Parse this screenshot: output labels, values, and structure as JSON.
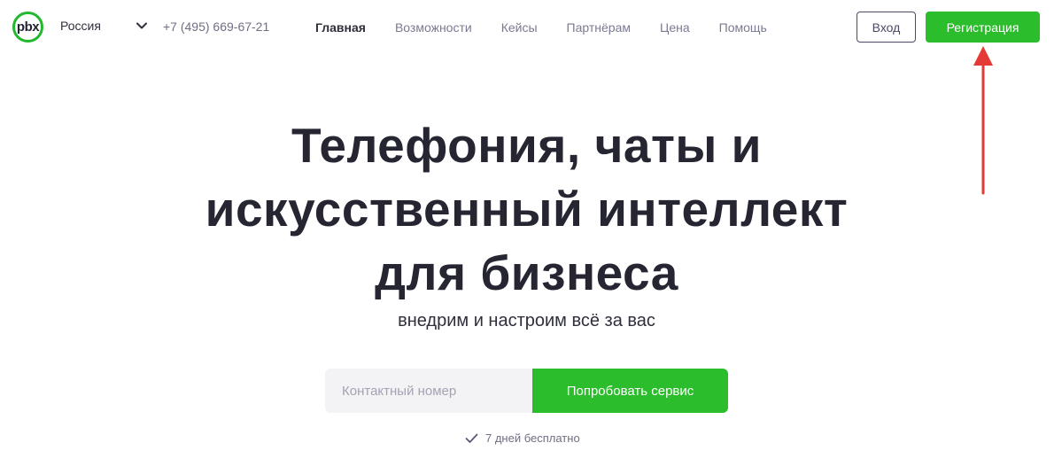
{
  "header": {
    "logo_text": "pbx",
    "region": "Россия",
    "phone": "+7 (495) 669-67-21",
    "nav": [
      {
        "label": "Главная",
        "active": true
      },
      {
        "label": "Возможности",
        "active": false
      },
      {
        "label": "Кейсы",
        "active": false
      },
      {
        "label": "Партнёрам",
        "active": false
      },
      {
        "label": "Цена",
        "active": false
      },
      {
        "label": "Помощь",
        "active": false
      }
    ],
    "login_label": "Вход",
    "register_label": "Регистрация"
  },
  "hero": {
    "title_lines": [
      "Телефония, чаты и",
      "искусственный интеллект",
      "для бизнеса"
    ],
    "subtitle": "внедрим и настроим всё за вас",
    "phone_placeholder": "Контактный номер",
    "try_label": "Попробовать сервис",
    "trial_note": "7 дней бесплатно"
  },
  "colors": {
    "accent": "#2bbd2b",
    "annotation_arrow": "#e53935",
    "text_dark": "#262633"
  }
}
